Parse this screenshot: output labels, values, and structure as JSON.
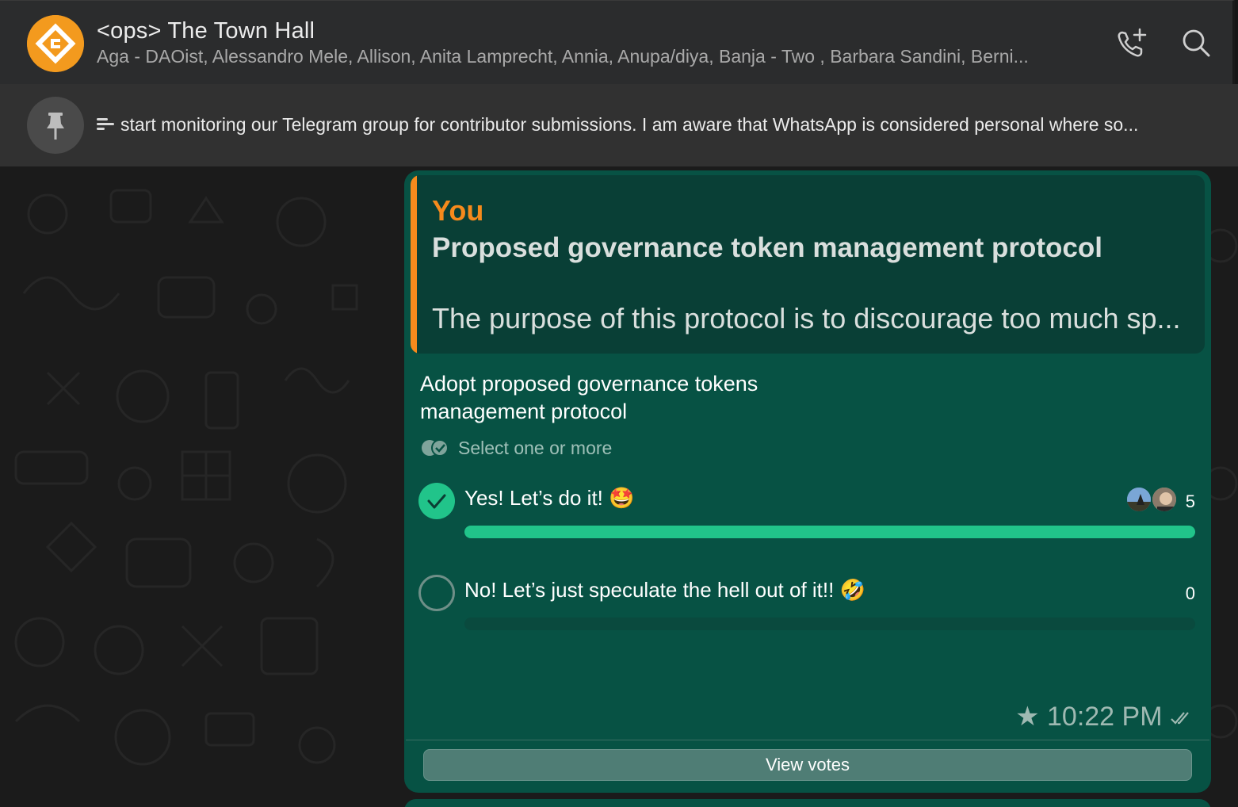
{
  "header": {
    "title": "<ops> The Town Hall",
    "subtitle": "Aga - DAOist, Alessandro Mele, Allison, Anita Lamprecht, Annia, Anupa/diya, Banja - Two , Barbara Sandini, Berni...",
    "avatar_color": "#f39a1e",
    "icons": [
      "add-call-icon",
      "search-icon"
    ]
  },
  "pinned": {
    "icon": "pin-icon",
    "text": "start monitoring our Telegram group for contributor submissions. I am aware that WhatsApp is considered personal where so..."
  },
  "message": {
    "quote": {
      "author": "You",
      "title": "Proposed governance token management protocol",
      "body": "The purpose of this protocol is to discourage too much sp...",
      "accent_color": "#f68a1c"
    },
    "poll": {
      "question": "Adopt proposed governance tokens management protocol",
      "hint": "Select one or more",
      "options": [
        {
          "label": "Yes! Let’s do it! 🤩",
          "votes": "5",
          "selected": true,
          "fill": 1.0
        },
        {
          "label": "No! Let’s just speculate the hell out of it!! 🤣",
          "votes": "0",
          "selected": false,
          "fill": 0.0
        }
      ]
    },
    "time": "★ 10:22 PM",
    "view_votes_label": "View votes",
    "bubble_color": "#075244",
    "bar_color": "#21c48a"
  }
}
